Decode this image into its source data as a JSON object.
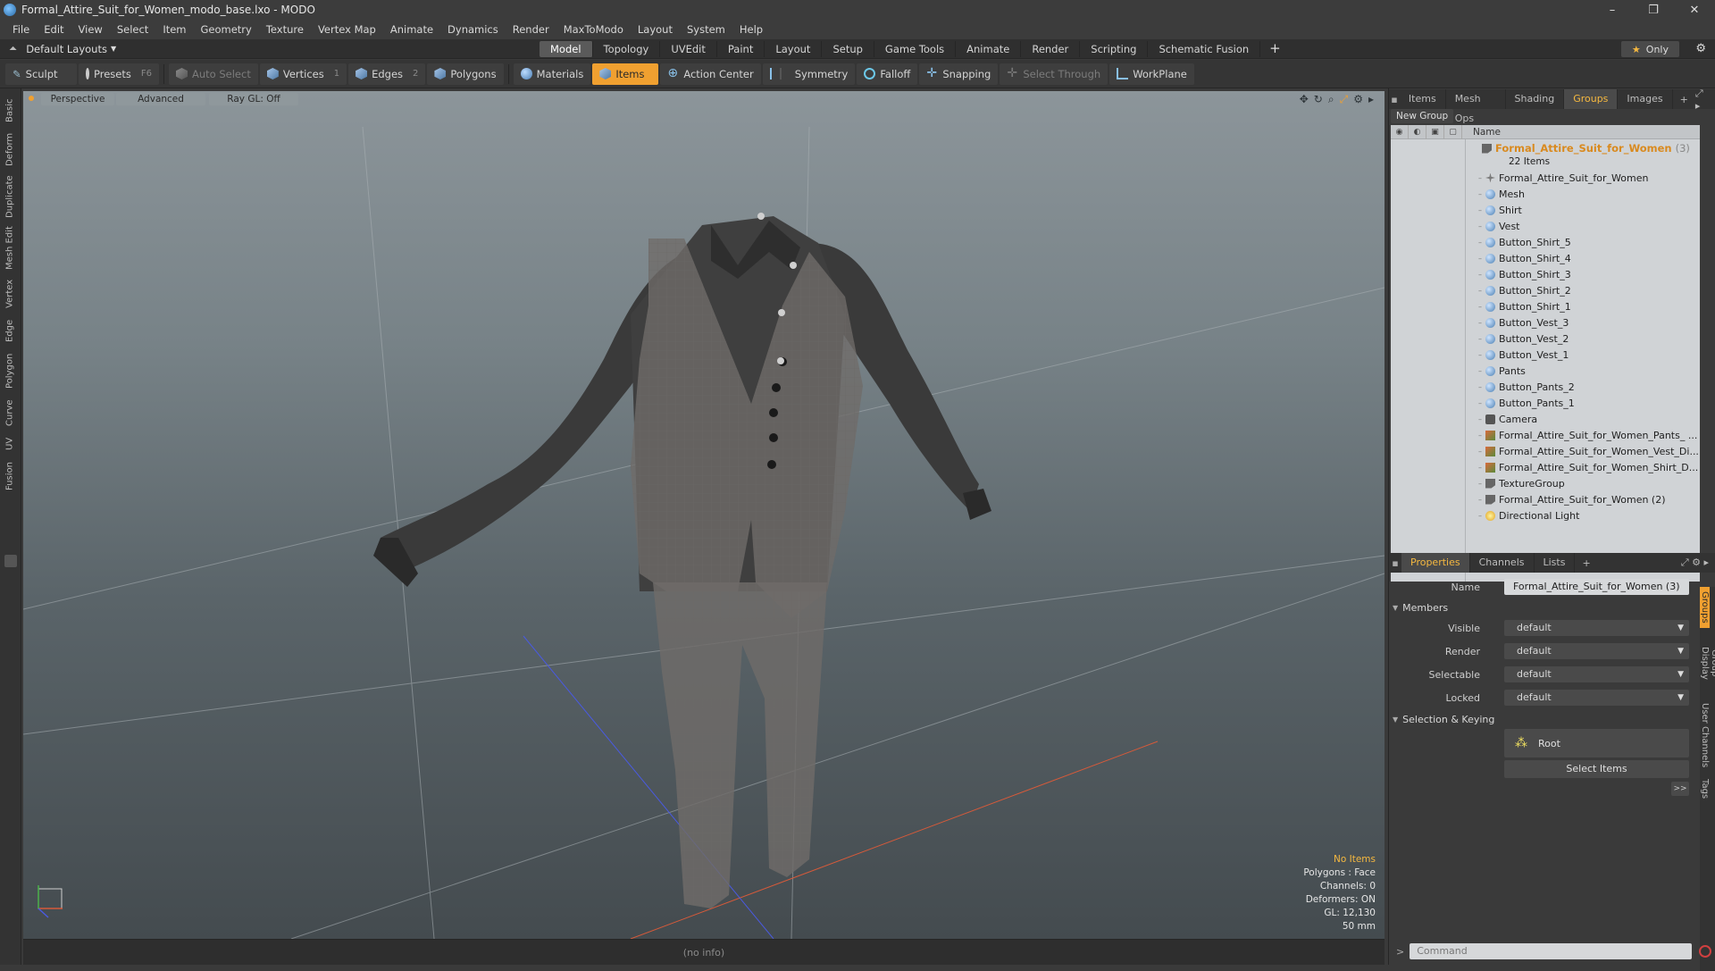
{
  "window": {
    "title": "Formal_Attire_Suit_for_Women_modo_base.lxo - MODO",
    "controls": [
      "–",
      "❐",
      "✕"
    ]
  },
  "menu": [
    "File",
    "Edit",
    "View",
    "Select",
    "Item",
    "Geometry",
    "Texture",
    "Vertex Map",
    "Animate",
    "Dynamics",
    "Render",
    "MaxToModo",
    "Layout",
    "System",
    "Help"
  ],
  "layoutbar": {
    "layout_selector": "Default Layouts",
    "tabs": [
      "Model",
      "Topology",
      "UVEdit",
      "Paint",
      "Layout",
      "Setup",
      "Game Tools",
      "Animate",
      "Render",
      "Scripting",
      "Schematic Fusion"
    ],
    "active_tab": "Model",
    "only_label": "Only"
  },
  "toolbar": {
    "sculpt": "Sculpt",
    "presets": "Presets",
    "presets_key": "F6",
    "auto_select": "Auto Select",
    "vertices": "Vertices",
    "vertices_count": "1",
    "edges": "Edges",
    "edges_count": "2",
    "polygons": "Polygons",
    "materials": "Materials",
    "items": "Items",
    "action_center": "Action Center",
    "symmetry": "Symmetry",
    "falloff": "Falloff",
    "snapping": "Snapping",
    "select_through": "Select Through",
    "workplane": "WorkPlane"
  },
  "left_tabs": [
    "Basic",
    "Deform",
    "Duplicate",
    "Mesh Edit",
    "Vertex",
    "Edge",
    "Polygon",
    "Curve",
    "UV",
    "Fusion"
  ],
  "viewport": {
    "view": "Perspective",
    "shading": "Advanced",
    "raygl": "Ray GL: Off",
    "hud": {
      "warning": "No Items",
      "lines": [
        "Polygons : Face",
        "Channels: 0",
        "Deformers: ON",
        "GL: 12,130",
        "50 mm"
      ]
    },
    "status": "(no info)"
  },
  "panel_top": {
    "tabs": [
      "Items",
      "Mesh Ops",
      "Shading",
      "Groups",
      "Images"
    ],
    "active_tab": "Groups",
    "new_group": "New Group",
    "column_name": "Name",
    "group": {
      "name": "Formal_Attire_Suit_for_Women",
      "count": "(3)",
      "items_label": "22 Items"
    },
    "items": [
      {
        "label": "Formal_Attire_Suit_for_Women",
        "icon": "locator-icon"
      },
      {
        "label": "Mesh",
        "icon": "mesh-icon"
      },
      {
        "label": "Shirt",
        "icon": "mesh-icon"
      },
      {
        "label": "Vest",
        "icon": "mesh-icon"
      },
      {
        "label": "Button_Shirt_5",
        "icon": "mesh-icon"
      },
      {
        "label": "Button_Shirt_4",
        "icon": "mesh-icon"
      },
      {
        "label": "Button_Shirt_3",
        "icon": "mesh-icon"
      },
      {
        "label": "Button_Shirt_2",
        "icon": "mesh-icon"
      },
      {
        "label": "Button_Shirt_1",
        "icon": "mesh-icon"
      },
      {
        "label": "Button_Vest_3",
        "icon": "mesh-icon"
      },
      {
        "label": "Button_Vest_2",
        "icon": "mesh-icon"
      },
      {
        "label": "Button_Vest_1",
        "icon": "mesh-icon"
      },
      {
        "label": "Pants",
        "icon": "mesh-icon"
      },
      {
        "label": "Button_Pants_2",
        "icon": "mesh-icon"
      },
      {
        "label": "Button_Pants_1",
        "icon": "mesh-icon"
      },
      {
        "label": "Camera",
        "icon": "camera-icon"
      },
      {
        "label": "Formal_Attire_Suit_for_Women_Pants_ ...",
        "icon": "texture-icon"
      },
      {
        "label": "Formal_Attire_Suit_for_Women_Vest_Di...",
        "icon": "texture-icon"
      },
      {
        "label": "Formal_Attire_Suit_for_Women_Shirt_D...",
        "icon": "texture-icon"
      },
      {
        "label": "TextureGroup",
        "icon": "group-icon"
      },
      {
        "label": "Formal_Attire_Suit_for_Women (2)",
        "icon": "group-icon"
      },
      {
        "label": "Directional Light",
        "icon": "light-icon"
      }
    ]
  },
  "panel_bottom": {
    "tabs": [
      "Properties",
      "Channels",
      "Lists"
    ],
    "active_tab": "Properties",
    "name_label": "Name",
    "name_value": "Formal_Attire_Suit_for_Women (3)",
    "members_section": "Members",
    "fields": [
      {
        "label": "Visible",
        "value": "default"
      },
      {
        "label": "Render",
        "value": "default"
      },
      {
        "label": "Selectable",
        "value": "default"
      },
      {
        "label": "Locked",
        "value": "default"
      }
    ],
    "selection_section": "Selection & Keying",
    "root_label": "Root",
    "select_items": "Select Items",
    "more": ">>",
    "side_tabs": [
      "Groups",
      "Group Display",
      "User Channels",
      "Tags"
    ],
    "command_placeholder": "Command"
  },
  "colors": {
    "accent": "#f0a030",
    "group_name": "#d98a1f"
  }
}
